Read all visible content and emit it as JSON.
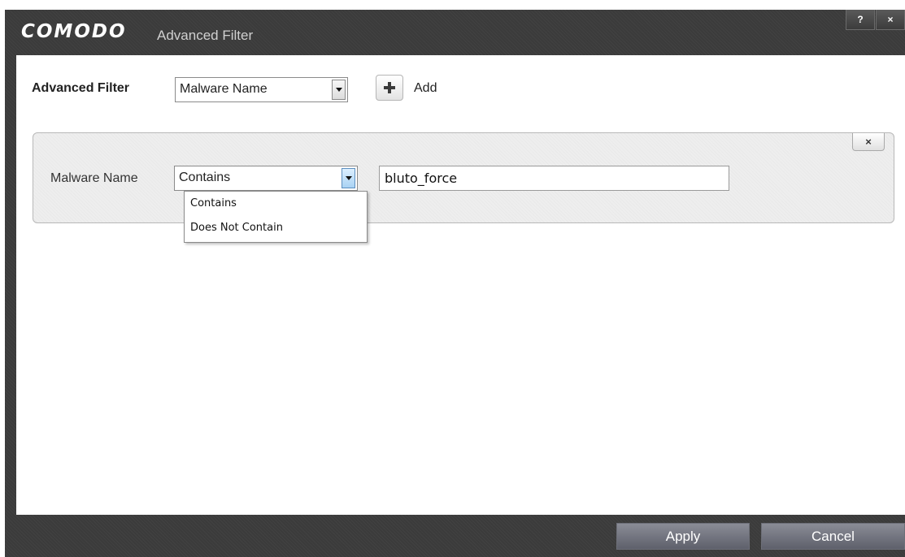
{
  "window": {
    "brand": "COMODO",
    "title": "Advanced Filter",
    "help_label": "?",
    "close_label": "×"
  },
  "filter_row": {
    "label": "Advanced Filter",
    "filter_select_value": "Malware Name",
    "add_label": "Add"
  },
  "condition": {
    "field_label": "Malware Name",
    "operator_value": "Contains",
    "text_value": "bluto_force",
    "remove_label": "×"
  },
  "operator_options": [
    "Contains",
    "Does Not Contain"
  ],
  "footer": {
    "apply_label": "Apply",
    "cancel_label": "Cancel"
  }
}
